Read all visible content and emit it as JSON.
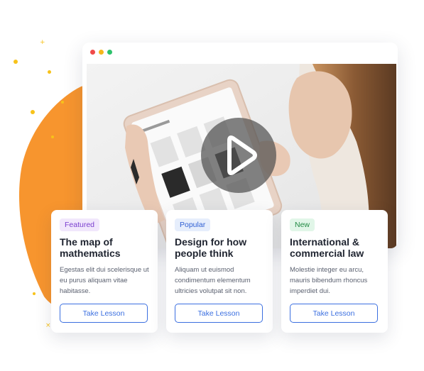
{
  "colors": {
    "accent": "#3b6fe0",
    "orange_blob": "#f7952e",
    "dots": "#f7c21a",
    "window_dot_red": "#f04a4a",
    "window_dot_yellow": "#f6b71c",
    "window_dot_green": "#2ec26c"
  },
  "video": {
    "play_icon": "play-icon"
  },
  "courses": [
    {
      "badge": "Featured",
      "badge_color": "#7a3ecf",
      "badge_bg": "#f1e7fc",
      "title": "The map of mathematics",
      "description": "Egestas elit dui scelerisque ut eu purus aliquam vitae habitasse.",
      "button": "Take Lesson"
    },
    {
      "badge": "Popular",
      "badge_color": "#2f5fd3",
      "badge_bg": "#e6eefc",
      "title": "Design for how people think",
      "description": "Aliquam ut euismod condimentum elementum ultricies volutpat sit non.",
      "button": "Take Lesson"
    },
    {
      "badge": "New",
      "badge_color": "#218a44",
      "badge_bg": "#e1f6e8",
      "title": "International & commercial law",
      "description": "Molestie integer eu arcu, mauris bibendum rhoncus imperdiet dui.",
      "button": "Take Lesson"
    }
  ]
}
